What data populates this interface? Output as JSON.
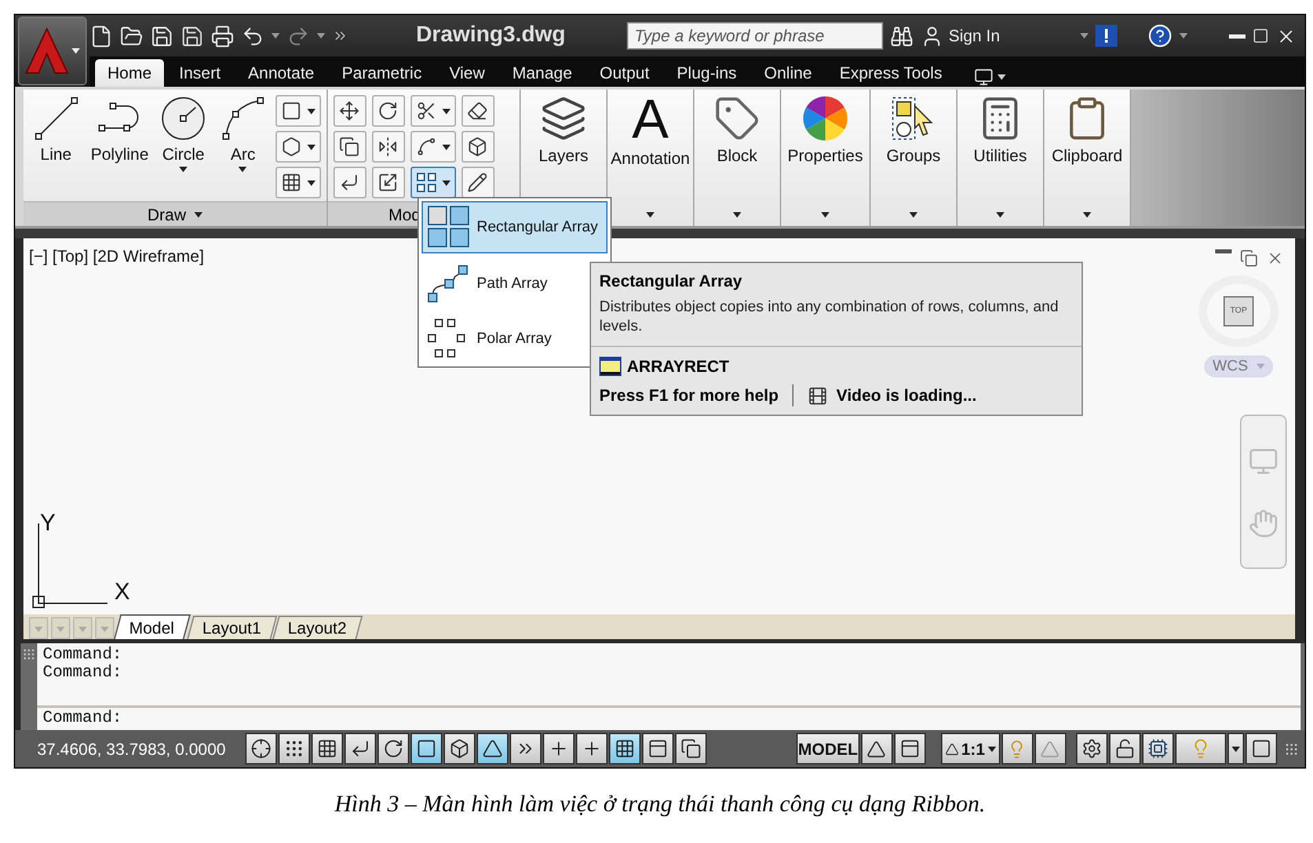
{
  "title_bar": {
    "title": "Drawing3.dwg",
    "search": {
      "placeholder": "Type a keyword or phrase"
    },
    "sign_in": "Sign In"
  },
  "tabs": [
    {
      "label": "Home",
      "selected": true
    },
    {
      "label": "Insert",
      "selected": false
    },
    {
      "label": "Annotate",
      "selected": false
    },
    {
      "label": "Parametric",
      "selected": false
    },
    {
      "label": "View",
      "selected": false
    },
    {
      "label": "Manage",
      "selected": false
    },
    {
      "label": "Output",
      "selected": false
    },
    {
      "label": "Plug-ins",
      "selected": false
    },
    {
      "label": "Online",
      "selected": false
    },
    {
      "label": "Express Tools",
      "selected": false
    }
  ],
  "ribbon": {
    "draw_panel": {
      "title": "Draw",
      "tools": [
        {
          "label": "Line",
          "has_menu": false
        },
        {
          "label": "Polyline",
          "has_menu": false
        },
        {
          "label": "Circle",
          "has_menu": true
        },
        {
          "label": "Arc",
          "has_menu": true
        }
      ]
    },
    "modify_panel": {
      "title": "Mod"
    },
    "panels": [
      {
        "label": "Layers"
      },
      {
        "label": "Annotation",
        "glyph": "A"
      },
      {
        "label": "Block"
      },
      {
        "label": "Properties"
      },
      {
        "label": "Groups"
      },
      {
        "label": "Utilities"
      },
      {
        "label": "Clipboard"
      }
    ]
  },
  "array_menu": {
    "items": [
      {
        "label": "Rectangular Array",
        "selected": true
      },
      {
        "label": "Path Array",
        "selected": false
      },
      {
        "label": "Polar Array",
        "selected": false
      }
    ]
  },
  "tooltip": {
    "title": "Rectangular Array",
    "description": "Distributes object copies into any combination of rows, columns, and levels.",
    "command": "ARRAYRECT",
    "help": "Press F1 for more help",
    "video": "Video is loading..."
  },
  "viewport": {
    "label": "[−] [Top] [2D Wireframe]",
    "viewcube_face": "TOP",
    "ucs_menu": "WCS",
    "axis_x": "X",
    "axis_y": "Y"
  },
  "layout_tabs": [
    {
      "label": "Model",
      "selected": true
    },
    {
      "label": "Layout1",
      "selected": false
    },
    {
      "label": "Layout2",
      "selected": false
    }
  ],
  "command_history": [
    "Command:",
    "Command:"
  ],
  "command_prompt": "Command:",
  "status_bar": {
    "coordinates": "37.4606, 33.7983, 0.0000",
    "toggles": [
      {
        "on": false
      },
      {
        "on": false
      },
      {
        "on": false
      },
      {
        "on": false
      },
      {
        "on": false
      },
      {
        "on": true
      },
      {
        "on": false
      },
      {
        "on": true
      },
      {
        "on": false
      },
      {
        "on": false
      },
      {
        "on": false
      },
      {
        "on": true
      },
      {
        "on": false
      },
      {
        "on": false
      }
    ],
    "space": "MODEL",
    "scale": "1:1"
  },
  "caption": "Hình 3 – Màn hình làm việc ở trạng thái thanh công cụ dạng Ribbon."
}
